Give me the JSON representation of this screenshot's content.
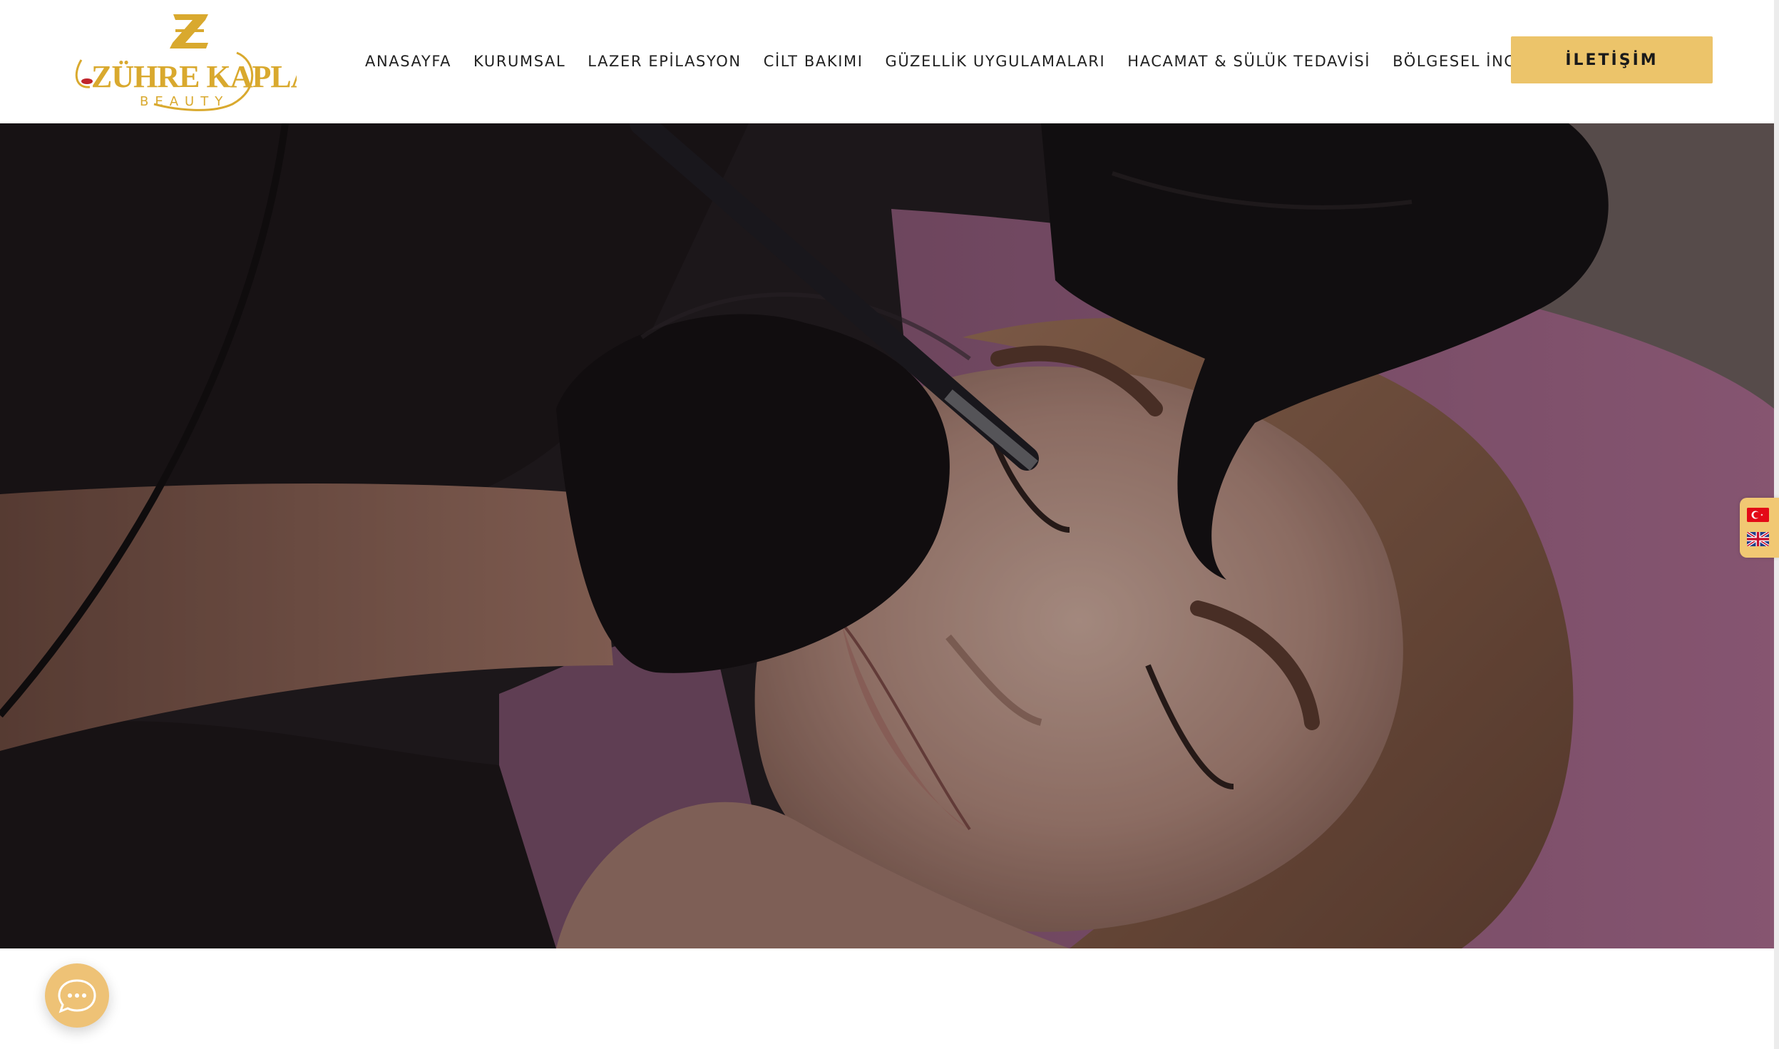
{
  "brand": {
    "logo_line1": "ZÜHRE KAPLAN",
    "logo_line2": "BEAUTY",
    "monogram": "Z",
    "gold": "#d9a92e",
    "accent_red": "#c0242b"
  },
  "nav": {
    "items": [
      {
        "label": "ANASAYFA"
      },
      {
        "label": "KURUMSAL"
      },
      {
        "label": "LAZER EPİLASYON"
      },
      {
        "label": "CİLT BAKIMI"
      },
      {
        "label": "GÜZELLİK UYGULAMALARI"
      },
      {
        "label": "HACAMAT & SÜLÜK TEDAVİSİ"
      },
      {
        "label": "BÖLGESEL İNCELME"
      }
    ]
  },
  "cta": {
    "label": "İLETİŞİM",
    "color": "#ecc46a"
  },
  "hero": {
    "image": "permanent-eyebrow-treatment-photo"
  },
  "language_switcher": {
    "flags": [
      {
        "code": "tr",
        "icon": "turkey-flag-icon"
      },
      {
        "code": "en",
        "icon": "uk-flag-icon"
      }
    ],
    "color": "#f1c873"
  },
  "chat": {
    "icon": "chat-bubble-icon",
    "color": "#eec276"
  }
}
